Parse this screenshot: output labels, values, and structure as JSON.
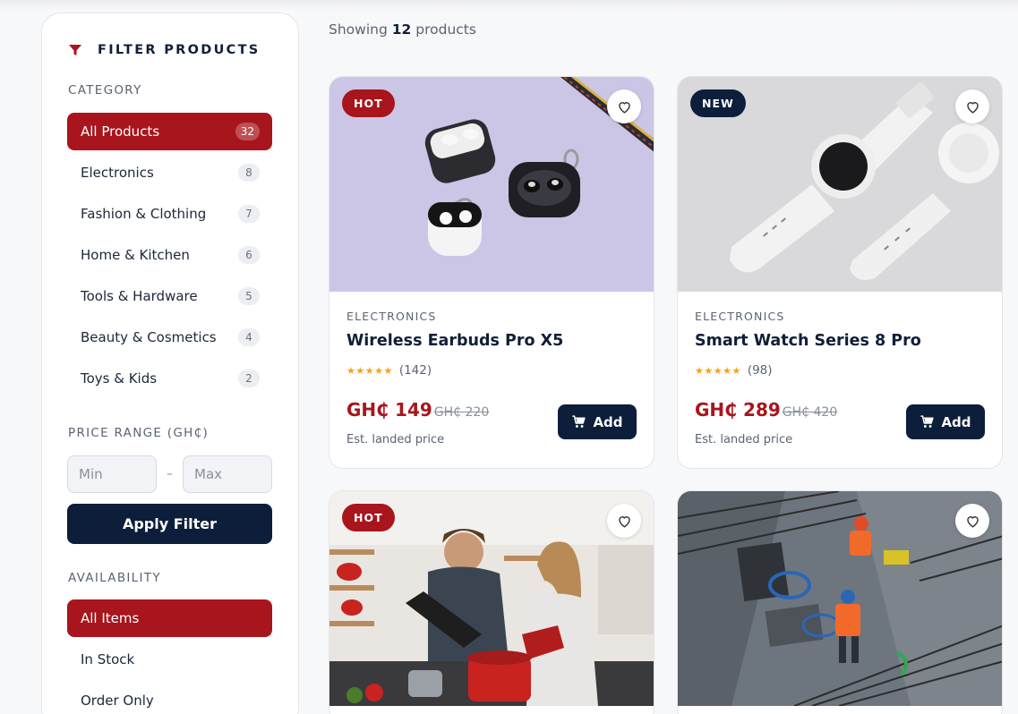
{
  "colors": {
    "brand_red": "#a8151c",
    "navy": "#0c1e3a",
    "star": "#f0a41c"
  },
  "sidebar": {
    "title": "FILTER PRODUCTS",
    "title_icon": "filter-icon",
    "category_label": "CATEGORY",
    "categories": [
      {
        "label": "All Products",
        "count": "32",
        "active": true
      },
      {
        "label": "Electronics",
        "count": "8"
      },
      {
        "label": "Fashion & Clothing",
        "count": "7"
      },
      {
        "label": "Home & Kitchen",
        "count": "6"
      },
      {
        "label": "Tools & Hardware",
        "count": "5"
      },
      {
        "label": "Beauty & Cosmetics",
        "count": "4"
      },
      {
        "label": "Toys & Kids",
        "count": "2"
      }
    ],
    "price_label": "PRICE RANGE (GH₵)",
    "min_placeholder": "Min",
    "max_placeholder": "Max",
    "dash": "–",
    "apply_label": "Apply Filter",
    "availability_label": "AVAILABILITY",
    "availability": [
      {
        "label": "All Items",
        "active": true
      },
      {
        "label": "In Stock"
      },
      {
        "label": "Order Only"
      }
    ]
  },
  "results": {
    "prefix": "Showing",
    "count": "12",
    "suffix": "products"
  },
  "products": [
    {
      "badge": "HOT",
      "category": "ELECTRONICS",
      "name": "Wireless Earbuds Pro X5",
      "stars": "★★★★★",
      "reviews": "(142)",
      "price": "GH₵ 149",
      "old_price": "GH₵ 220",
      "landed": "Est. landed price",
      "add_label": "Add"
    },
    {
      "badge": "NEW",
      "category": "ELECTRONICS",
      "name": "Smart Watch Series 8 Pro",
      "stars": "★★★★★",
      "reviews": "(98)",
      "price": "GH₵ 289",
      "old_price": "GH₵ 420",
      "landed": "Est. landed price",
      "add_label": "Add"
    },
    {
      "badge": "HOT"
    },
    {
      "badge": ""
    }
  ]
}
